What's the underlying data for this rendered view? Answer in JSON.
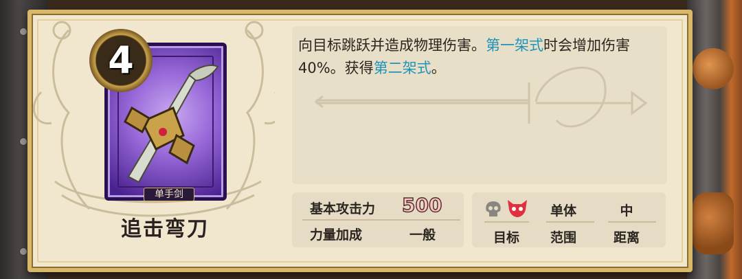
{
  "card": {
    "cost": "4",
    "weapon_type": "单手剑",
    "name": "追击弯刀"
  },
  "description": {
    "part1": "向目标跳跃并造成物理伤害。",
    "highlight1": "第一架式",
    "part2": "时会增加伤害40%。获得",
    "highlight2": "第二架式",
    "part3": "。"
  },
  "stats": {
    "base_attack_label": "基本攻击力",
    "base_attack_value": "500",
    "strength_bonus_label": "力量加成",
    "strength_bonus_value": "一般"
  },
  "targeting": {
    "target_label": "目标",
    "range_label": "范围",
    "range_value": "单体",
    "distance_label": "距离",
    "distance_value": "中",
    "icons": [
      "skull-icon",
      "demon-icon"
    ]
  },
  "colors": {
    "highlight": "#1f94b8",
    "card_frame": "#7a48c8",
    "parchment": "#f1e7cf"
  }
}
